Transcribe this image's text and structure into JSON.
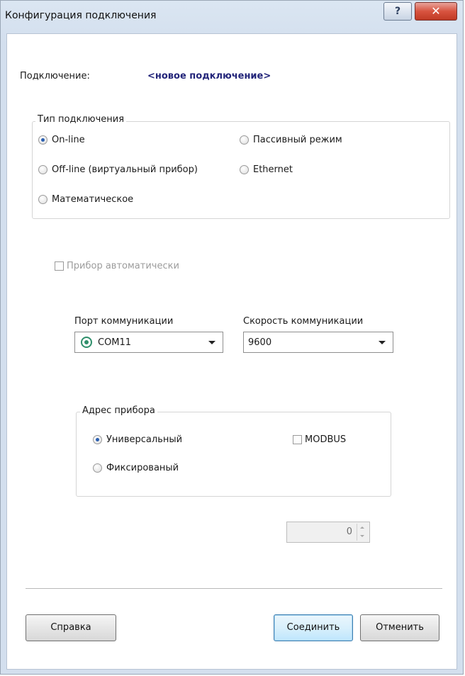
{
  "window": {
    "title": "Конфигурация подключения",
    "help_glyph": "?",
    "close_glyph": "✕"
  },
  "connection": {
    "label": "Подключение:",
    "value": "<новое подключение>"
  },
  "connection_type": {
    "group_title": "Тип подключения",
    "options": [
      {
        "label": "On-line",
        "selected": true
      },
      {
        "label": "Пассивный режим",
        "selected": false
      },
      {
        "label": "Off-line (виртуальный прибор)",
        "selected": false
      },
      {
        "label": "Ethernet",
        "selected": false
      },
      {
        "label": "Математическое",
        "selected": false
      }
    ]
  },
  "auto_device": {
    "label": "Прибор автоматически",
    "checked": false,
    "enabled": false
  },
  "port": {
    "label": "Порт коммуникации",
    "value": "COM11",
    "icon": "serial-port-icon"
  },
  "speed": {
    "label": "Скорость коммуникации",
    "value": "9600"
  },
  "device_address": {
    "group_title": "Адрес прибора",
    "options": [
      {
        "label": "Универсальный",
        "selected": true
      },
      {
        "label": "Фиксированый",
        "selected": false
      }
    ],
    "modbus_label": "MODBUS",
    "modbus_checked": false,
    "address_value": "0"
  },
  "buttons": {
    "help": "Справка",
    "connect": "Соединить",
    "cancel": "Отменить"
  },
  "colors": {
    "connection_value": "#23257a",
    "radio_selected": "#2a5fb0",
    "close_button": "#d8533f"
  }
}
